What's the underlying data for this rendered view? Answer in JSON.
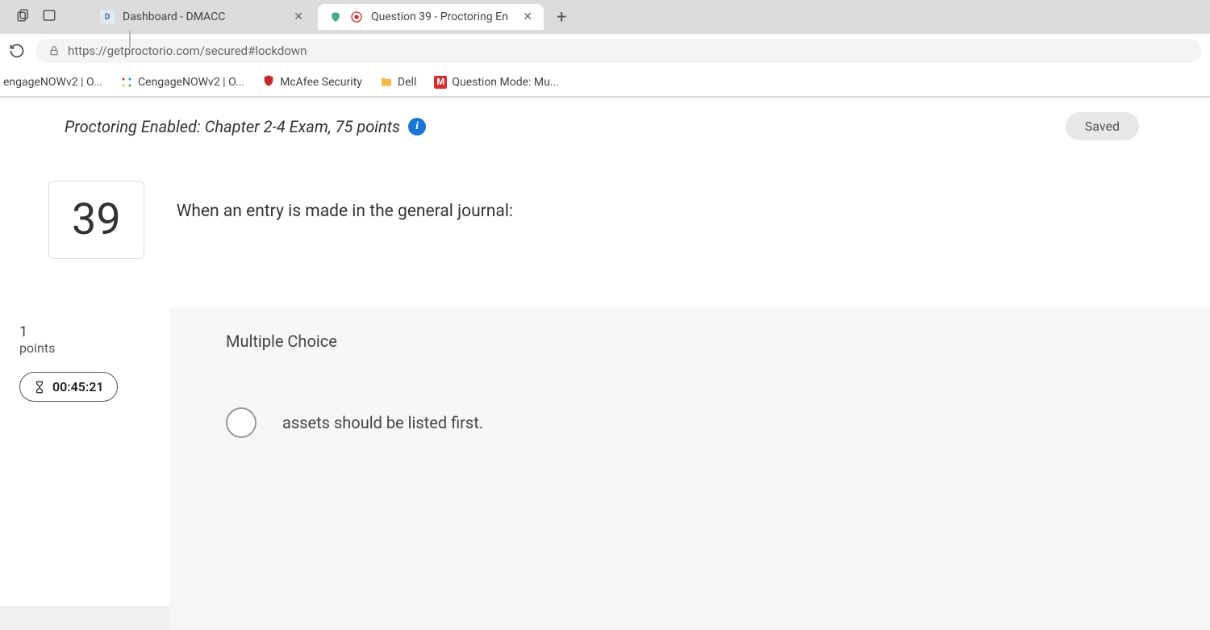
{
  "browser": {
    "tabs": [
      {
        "title": "Dashboard - DMACC",
        "active": false
      },
      {
        "title": "Question 39 - Proctoring En",
        "active": true
      }
    ],
    "url": "https://getproctorio.com/secured#lockdown"
  },
  "bookmarks": [
    {
      "label": "engageNOWv2 | O..."
    },
    {
      "label": "CengageNOWv2 | O..."
    },
    {
      "label": "McAfee Security"
    },
    {
      "label": "Dell"
    },
    {
      "label": "Question Mode: Mu..."
    }
  ],
  "exam": {
    "header": "Proctoring Enabled: Chapter 2-4 Exam, 75 points",
    "saved_label": "Saved",
    "question_number": "39",
    "question_text": "When an entry is made in the general journal:",
    "points_value": "1",
    "points_label": "points",
    "timer": "00:45:21",
    "section_label": "Multiple Choice",
    "options": [
      {
        "text": "assets should be listed first."
      }
    ]
  }
}
